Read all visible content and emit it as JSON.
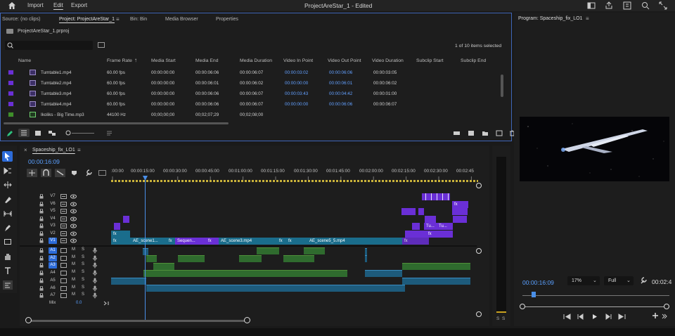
{
  "topbar": {
    "menu": [
      "Import",
      "Edit",
      "Export"
    ],
    "active_menu": "Edit",
    "title": "ProjectAreStar_1 - Edited"
  },
  "project_panel": {
    "tabs": [
      "Source: (no clips)",
      "Project: ProjectAreStar_1",
      "Bin: Bin",
      "Media Browser",
      "Properties"
    ],
    "active_tab": "Project: ProjectAreStar_1",
    "project_file": "ProjectAreStar_1.prproj",
    "search_placeholder": "",
    "items_status": "1 of 10 items selected",
    "columns": [
      "Name",
      "Frame Rate",
      "Media Start",
      "Media End",
      "Media Duration",
      "Video In Point",
      "Video Out Point",
      "Video Duration",
      "Subclip Start",
      "Subclip End"
    ],
    "rows": [
      {
        "color": "#6a2fd6",
        "name": "Tumtable1.mp4",
        "fps": "60.00 fps",
        "ms": "00:00:00:00",
        "me": "00:00:06:06",
        "md": "00:00:06:07",
        "vin": "00:00:03:02",
        "vout": "00:00:06:06",
        "vd": "00:00:03:05"
      },
      {
        "color": "#6a2fd6",
        "name": "Tumtable2.mp4",
        "fps": "60.00 fps",
        "ms": "00:00:00:00",
        "me": "00:00:06:01",
        "md": "00:00:06:02",
        "vin": "00:00:00:00",
        "vout": "00:00:06:01",
        "vd": "00:00:06:02"
      },
      {
        "color": "#6a2fd6",
        "name": "Tumtable3.mp4",
        "fps": "60.00 fps",
        "ms": "00:00:00:00",
        "me": "00:00:06:06",
        "md": "00:00:06:07",
        "vin": "00:00:03:43",
        "vout": "00:00:04:42",
        "vd": "00:00:01:00"
      },
      {
        "color": "#6a2fd6",
        "name": "Tumtable4.mp4",
        "fps": "60.00 fps",
        "ms": "00:00:00:00",
        "me": "00:00:06:06",
        "md": "00:00:06:07",
        "vin": "00:00:00:00",
        "vout": "00:00:06:06",
        "vd": "00:00:06:07"
      },
      {
        "color": "#3f8f2a",
        "name": "Ikoliks - Big Time.mp3",
        "fps": "44100 Hz",
        "ms": "00;00;00;00",
        "me": "00;02;07;29",
        "md": "00;02;08;00",
        "vin": "",
        "vout": "",
        "vd": ""
      }
    ]
  },
  "program": {
    "title": "Program: Spaceship_fix_LO1",
    "timecode": "00:00:16:09",
    "zoom": "17%",
    "quality": "Full",
    "duration_partial": "00:02:4"
  },
  "timeline": {
    "sequence_tab": "Spaceship_fix_LO1",
    "timecode": "00:00:16:09",
    "ruler": [
      ":00:00",
      "00:00:15:00",
      "00:00:30:00",
      "00:00:45:00",
      "00:01:00:00",
      "00:01:15:00",
      "00:01:30:00",
      "00:01:45:00",
      "00:02:00:00",
      "00:02:15:00",
      "00:02:30:00",
      "00:02:45"
    ],
    "video_tracks": [
      "V7",
      "V6",
      "V5",
      "V4",
      "V3",
      "V2",
      "V1"
    ],
    "audio_tracks": [
      "A1",
      "A2",
      "A3",
      "A4",
      "A5",
      "A6",
      "A7"
    ],
    "mix_label": "Mix",
    "mix_value": "0.0",
    "clip_labels": [
      "AE_scene1...",
      "Sequen...",
      "AE_scene3.mp4",
      "AE_scene5_5.mp4",
      "Tu...",
      "Tu..."
    ],
    "fx": "fx",
    "ms": [
      "M",
      "S"
    ]
  },
  "meter_labels": [
    "S",
    "S"
  ],
  "colors": {
    "accent": "#3f66b8",
    "video_clip": "#6a2fd6",
    "blue_clip": "#1a6d8c",
    "audio_green": "#2f6b2e",
    "audio_blue": "#1d5b7c",
    "timecode_blue": "#5aa0ff"
  }
}
